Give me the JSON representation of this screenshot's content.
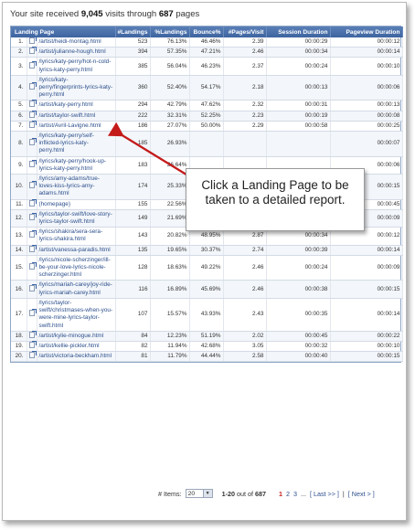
{
  "summary": {
    "prefix": "Your site received",
    "visits": "9,045",
    "middle": "visits through",
    "pages": "687",
    "suffix": "pages"
  },
  "table": {
    "headers": [
      "Landing Page",
      "#Landings",
      "%Landings",
      "Bounce%",
      "#Pages/Visit",
      "Session Duration",
      "Pageview Duration"
    ],
    "rows": [
      {
        "idx": "1.",
        "page": "/artist/heidi-montag.html",
        "landings": "523",
        "pct": "76.13%",
        "bounce": "46.46%",
        "ppv": "2.39",
        "session": "00:00:29",
        "pageview": "00:00:12"
      },
      {
        "idx": "2.",
        "page": "/artist/julianne-hough.html",
        "landings": "394",
        "pct": "57.35%",
        "bounce": "47.21%",
        "ppv": "2.46",
        "session": "00:00:34",
        "pageview": "00:00:14"
      },
      {
        "idx": "3.",
        "page": "/lyrics/katy-perry/hot-n-cold-lyrics-katy-perry.html",
        "landings": "385",
        "pct": "56.04%",
        "bounce": "46.23%",
        "ppv": "2.37",
        "session": "00:00:24",
        "pageview": "00:00:10"
      },
      {
        "idx": "4.",
        "page": "/lyrics/katy-perry/fingerprints-lyrics-katy-perry.html",
        "landings": "360",
        "pct": "52.40%",
        "bounce": "54.17%",
        "ppv": "2.18",
        "session": "00:00:13",
        "pageview": "00:00:06"
      },
      {
        "idx": "5.",
        "page": "/artist/katy-perry.html",
        "landings": "294",
        "pct": "42.79%",
        "bounce": "47.62%",
        "ppv": "2.32",
        "session": "00:00:31",
        "pageview": "00:00:13"
      },
      {
        "idx": "6.",
        "page": "/artist/taylor-swift.html",
        "landings": "222",
        "pct": "32.31%",
        "bounce": "52.25%",
        "ppv": "2.23",
        "session": "00:00:19",
        "pageview": "00:00:08"
      },
      {
        "idx": "7.",
        "page": "/artist/Avril-Lavigne.html",
        "landings": "186",
        "pct": "27.07%",
        "bounce": "50.00%",
        "ppv": "2.29",
        "session": "00:00:58",
        "pageview": "00:00:25"
      },
      {
        "idx": "8.",
        "page": "/lyrics/katy-perry/self-inflicted-lyrics-katy-perry.html",
        "landings": "185",
        "pct": "26.93%",
        "bounce": "",
        "ppv": "",
        "session": "",
        "pageview": "00:00:07"
      },
      {
        "idx": "9.",
        "page": "/lyrics/katy-perry/hook-up-lyrics-katy-perry.html",
        "landings": "183",
        "pct": "26.64%",
        "bounce": "",
        "ppv": "",
        "session": "",
        "pageview": "00:00:06"
      },
      {
        "idx": "10.",
        "page": "/lyrics/amy-adams/true-loves-kiss-lyrics-amy-adams.html",
        "landings": "174",
        "pct": "25.33%",
        "bounce": "",
        "ppv": "",
        "session": "",
        "pageview": "00:00:15"
      },
      {
        "idx": "11.",
        "page": "(homepage)",
        "landings": "155",
        "pct": "22.56%",
        "bounce": "58.71%",
        "ppv": "2.05",
        "session": "00:01:34",
        "pageview": "00:00:45"
      },
      {
        "idx": "12.",
        "page": "/lyrics/taylor-swift/love-story-lyrics-taylor-swift.html",
        "landings": "149",
        "pct": "21.69%",
        "bounce": "48.32%",
        "ppv": "2.20",
        "session": "00:00:20",
        "pageview": "00:00:09"
      },
      {
        "idx": "13.",
        "page": "/lyrics/shakira/sera-sera-lyrics-shakira.html",
        "landings": "143",
        "pct": "20.82%",
        "bounce": "48.95%",
        "ppv": "2.87",
        "session": "00:00:34",
        "pageview": "00:00:12"
      },
      {
        "idx": "14.",
        "page": "/artist/vanessa-paradis.html",
        "landings": "135",
        "pct": "19.65%",
        "bounce": "30.37%",
        "ppv": "2.74",
        "session": "00:00:39",
        "pageview": "00:00:14"
      },
      {
        "idx": "15.",
        "page": "/lyrics/nicole-scherzinger/ill-be-your-love-lyrics-nicole-scherzinger.html",
        "landings": "128",
        "pct": "18.63%",
        "bounce": "49.22%",
        "ppv": "2.46",
        "session": "00:00:24",
        "pageview": "00:00:09"
      },
      {
        "idx": "16.",
        "page": "/lyrics/mariah-carey/joy-ride-lyrics-mariah-carey.html",
        "landings": "116",
        "pct": "16.89%",
        "bounce": "45.69%",
        "ppv": "2.46",
        "session": "00:00:38",
        "pageview": "00:00:15"
      },
      {
        "idx": "17.",
        "page": "/lyrics/taylor-swift/christmases-when-you-were-mine-lyrics-taylor-swift.html",
        "landings": "107",
        "pct": "15.57%",
        "bounce": "43.93%",
        "ppv": "2.43",
        "session": "00:00:35",
        "pageview": "00:00:14"
      },
      {
        "idx": "18.",
        "page": "/artist/kylie-minogue.html",
        "landings": "84",
        "pct": "12.23%",
        "bounce": "51.19%",
        "ppv": "2.02",
        "session": "00:00:45",
        "pageview": "00:00:22"
      },
      {
        "idx": "19.",
        "page": "/artist/kellie-pickler.html",
        "landings": "82",
        "pct": "11.94%",
        "bounce": "42.68%",
        "ppv": "3.05",
        "session": "00:00:32",
        "pageview": "00:00:10"
      },
      {
        "idx": "20.",
        "page": "/artist/victoria-beckham.html",
        "landings": "81",
        "pct": "11.79%",
        "bounce": "44.44%",
        "ppv": "2.58",
        "session": "00:00:40",
        "pageview": "00:00:15"
      }
    ]
  },
  "pager": {
    "items_label": "# Items:",
    "items_value": "20",
    "range": "1-20",
    "out_of": "out of",
    "total": "687",
    "current_page": "1",
    "page2": "2",
    "page3": "3",
    "ellipsis": "...",
    "last": "[ Last >> ]",
    "next": "[ Next > ]"
  },
  "callout": {
    "text": "Click a Landing Page to be taken to a detailed report."
  },
  "colors": {
    "header_bg": "#4a70ab",
    "link": "#2c4f8c",
    "current_page": "#cc2222",
    "arrow": "#c41a1a"
  }
}
